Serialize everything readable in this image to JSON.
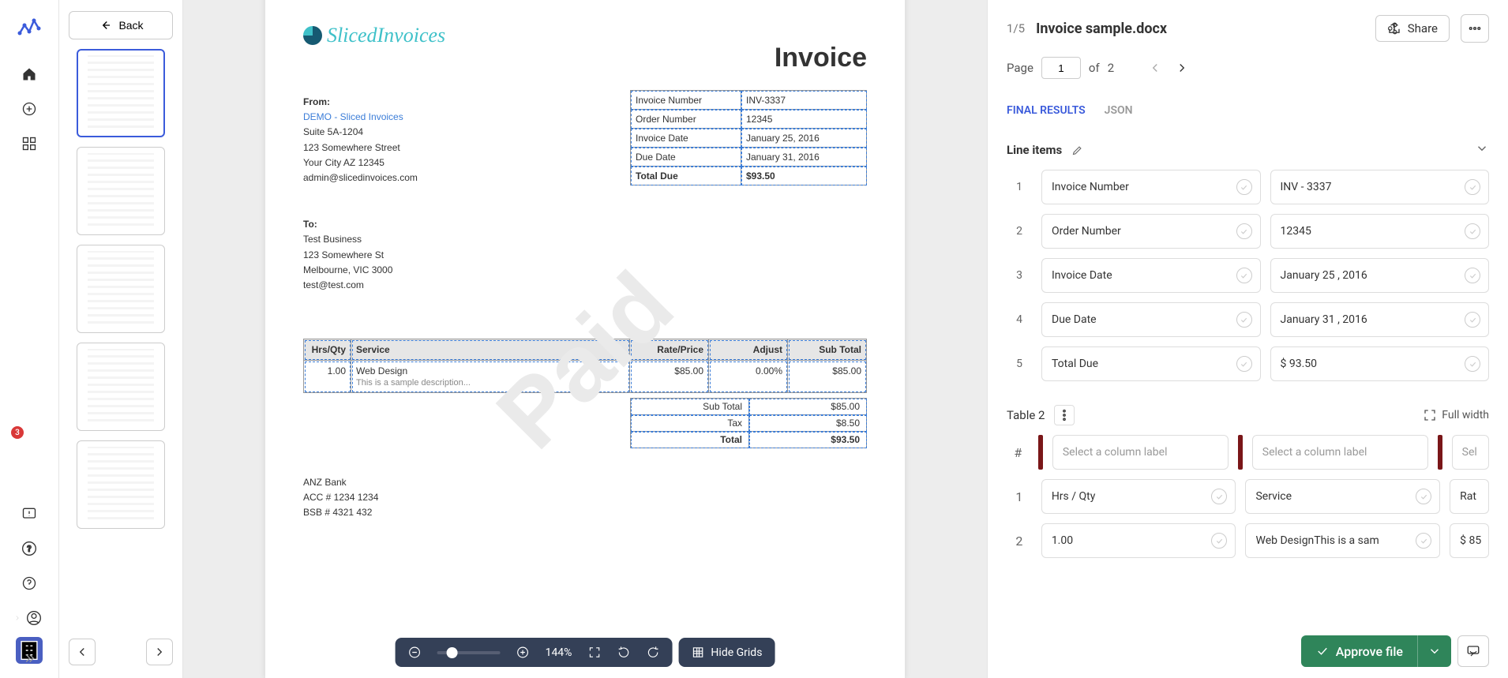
{
  "sidebar": {
    "back_label": "Back",
    "notif_count": "3"
  },
  "doc_header": {
    "counter": "1/5",
    "filename": "Invoice sample.docx",
    "share": "Share",
    "page_label": "Page",
    "page_current": "1",
    "page_of": "of",
    "page_total": "2"
  },
  "tabs": {
    "final": "FINAL RESULTS",
    "json": "JSON"
  },
  "section1": {
    "title": "Line items",
    "rows": [
      {
        "n": "1",
        "k": "Invoice Number",
        "v": "INV - 3337"
      },
      {
        "n": "2",
        "k": "Order Number",
        "v": "12345"
      },
      {
        "n": "3",
        "k": "Invoice Date",
        "v": "January 25 , 2016"
      },
      {
        "n": "4",
        "k": "Due Date",
        "v": "January 31 , 2016"
      },
      {
        "n": "5",
        "k": "Total Due",
        "v": "$ 93.50"
      }
    ]
  },
  "section2": {
    "title": "Table 2",
    "full_width": "Full width",
    "col_placeholder": "Select a column label",
    "rows": [
      {
        "n": "1",
        "c1": "Hrs / Qty",
        "c2": "Service",
        "c3": "Rat"
      },
      {
        "n": "2",
        "c1": "1.00",
        "c2": "Web DesignThis is a sam",
        "c3": "$ 85"
      }
    ]
  },
  "toolbar": {
    "zoom": "144%",
    "hide_grids": "Hide Grids"
  },
  "approve": "Approve file",
  "invoice": {
    "brand": "SlicedInvoices",
    "title": "Invoice",
    "watermark": "Paid",
    "from_label": "From:",
    "from_link": "DEMO - Sliced Invoices",
    "from_addr1": "Suite 5A-1204",
    "from_addr2": "123 Somewhere Street",
    "from_addr3": "Your City AZ 12345",
    "from_email": "admin@slicedinvoices.com",
    "to_label": "To:",
    "to_name": "Test Business",
    "to_addr1": "123 Somewhere St",
    "to_addr2": "Melbourne, VIC 3000",
    "to_email": "test@test.com",
    "info": [
      {
        "k": "Invoice Number",
        "v": "INV-3337"
      },
      {
        "k": "Order Number",
        "v": "12345"
      },
      {
        "k": "Invoice Date",
        "v": "January 25, 2016"
      },
      {
        "k": "Due Date",
        "v": "January 31, 2016"
      },
      {
        "k": "Total Due",
        "v": "$93.50"
      }
    ],
    "svc_hdr": {
      "h1": "Hrs/Qty",
      "h2": "Service",
      "h3": "Rate/Price",
      "h4": "Adjust",
      "h5": "Sub Total"
    },
    "svc_row": {
      "qty": "1.00",
      "name": "Web Design",
      "desc": "This is a sample description...",
      "rate": "$85.00",
      "adj": "0.00%",
      "sub": "$85.00"
    },
    "totals": [
      {
        "k": "Sub Total",
        "v": "$85.00"
      },
      {
        "k": "Tax",
        "v": "$8.50"
      },
      {
        "k": "Total",
        "v": "$93.50"
      }
    ],
    "bank1": "ANZ Bank",
    "bank2": "ACC # 1234 1234",
    "bank3": "BSB # 4321 432"
  }
}
